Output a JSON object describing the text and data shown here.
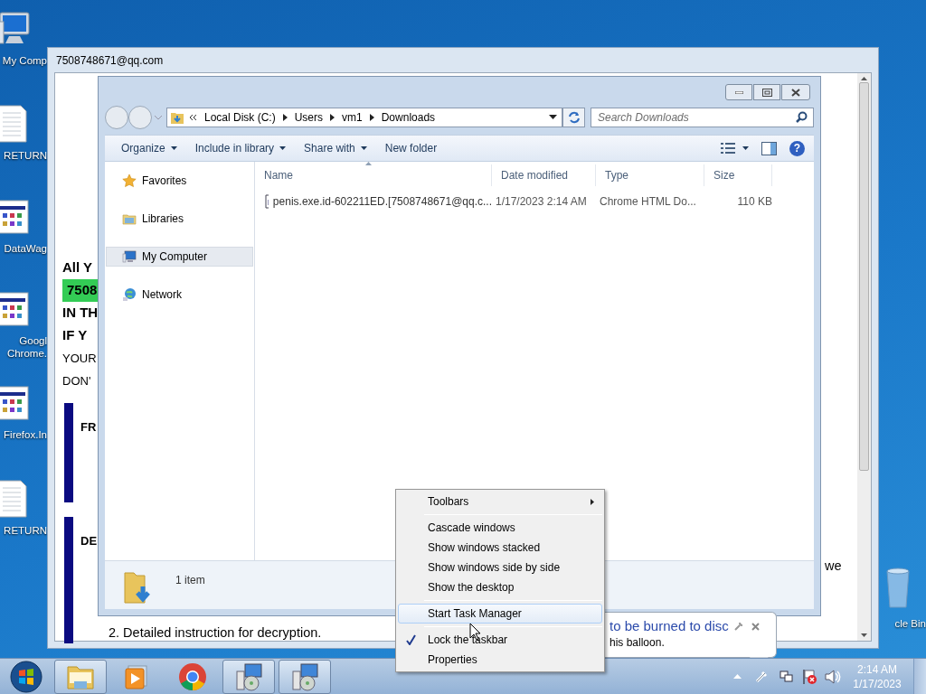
{
  "desktop_icons": [
    {
      "kind": "computer",
      "label_lines": [
        "My Comp"
      ]
    },
    {
      "kind": "document",
      "label_lines": [
        "RETURN"
      ]
    },
    {
      "kind": "app",
      "label_lines": [
        "DataWag"
      ]
    },
    {
      "kind": "app",
      "label_lines": [
        "Googl",
        "Chrome."
      ]
    },
    {
      "kind": "app",
      "label_lines": [
        "Firefox.In"
      ]
    },
    {
      "kind": "document",
      "label_lines": [
        "RETURN"
      ]
    }
  ],
  "recycle_bin": {
    "label": "cle Bin"
  },
  "note_window": {
    "title": "7508748671@qq.com",
    "lines": [
      {
        "text": "All Y",
        "kind": "bold"
      },
      {
        "text": "7508",
        "kind": "highlight"
      },
      {
        "text": "IN TH",
        "kind": "bold"
      },
      {
        "text": "IF Y",
        "kind": "bold"
      },
      {
        "text": "YOUR",
        "kind": "plain"
      },
      {
        "text": "DON'",
        "kind": "plain"
      }
    ],
    "sections": [
      {
        "heading": "FR"
      },
      {
        "heading": "DE"
      }
    ],
    "side_text": "we",
    "footer_line": "2. Detailed instruction for decryption."
  },
  "explorer": {
    "address": [
      "Local Disk (C:)",
      "Users",
      "vm1",
      "Downloads"
    ],
    "search": {
      "placeholder": "Search Downloads"
    },
    "toolbar": [
      {
        "label": "Organize",
        "dropdown": true
      },
      {
        "label": "Include in library",
        "dropdown": true
      },
      {
        "label": "Share with",
        "dropdown": true
      },
      {
        "label": "New folder",
        "dropdown": false
      }
    ],
    "nav": [
      {
        "label": "Favorites",
        "kind": "favorites",
        "selected": false
      },
      {
        "label": "Libraries",
        "kind": "libraries",
        "selected": false
      },
      {
        "label": "My Computer",
        "kind": "computer",
        "selected": true
      },
      {
        "label": "Network",
        "kind": "network",
        "selected": false
      }
    ],
    "columns": [
      "Name",
      "Date modified",
      "Type",
      "Size"
    ],
    "rows": [
      {
        "name": "penis.exe.id-602211ED.[7508748671@qq.c...",
        "date": "1/17/2023 2:14 AM",
        "type": "Chrome HTML Do...",
        "size": "110 KB"
      }
    ],
    "status": "1 item",
    "help": "?"
  },
  "context_menu": {
    "groups": [
      [
        {
          "label": "Toolbars",
          "kind": "submenu",
          "selected": false,
          "checked": false
        }
      ],
      [
        {
          "label": "Cascade windows",
          "kind": "command",
          "selected": false,
          "checked": false
        },
        {
          "label": "Show windows stacked",
          "kind": "command",
          "selected": false,
          "checked": false
        },
        {
          "label": "Show windows side by side",
          "kind": "command",
          "selected": false,
          "checked": false
        },
        {
          "label": "Show the desktop",
          "kind": "command",
          "selected": false,
          "checked": false
        }
      ],
      [
        {
          "label": "Start Task Manager",
          "kind": "command",
          "selected": true,
          "checked": false
        }
      ],
      [
        {
          "label": "Lock the taskbar",
          "kind": "command",
          "selected": false,
          "checked": true
        },
        {
          "label": "Properties",
          "kind": "command",
          "selected": false,
          "checked": false
        }
      ]
    ]
  },
  "balloon": {
    "title": "to be burned to disc",
    "text": "his balloon."
  },
  "taskbar": {
    "apps": [
      {
        "kind": "folder",
        "running": true
      },
      {
        "kind": "media",
        "running": false
      },
      {
        "kind": "browser",
        "running": false
      },
      {
        "kind": "setup",
        "running": true
      },
      {
        "kind": "setup",
        "running": true
      }
    ],
    "time": "2:14 AM",
    "date": "1/17/2023"
  }
}
